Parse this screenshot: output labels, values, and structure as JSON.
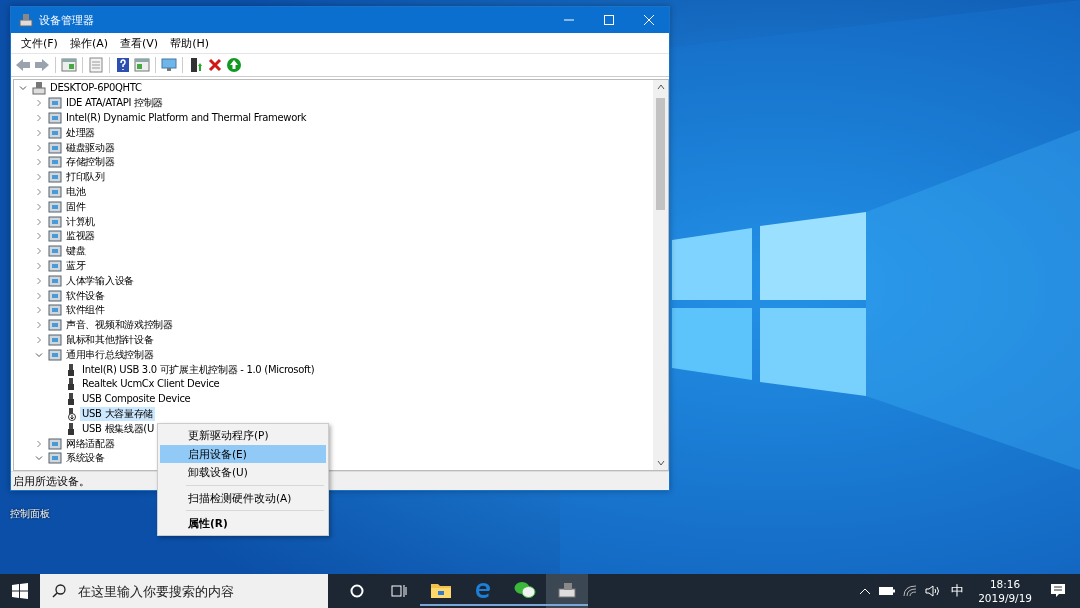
{
  "window": {
    "title": "设备管理器"
  },
  "menu_bar": [
    "文件(F)",
    "操作(A)",
    "查看(V)",
    "帮助(H)"
  ],
  "tree": [
    {
      "label": "DESKTOP-6P0QHTC",
      "expanded": true,
      "selected": false,
      "children": [
        {
          "label": "IDE ATA/ATAPI 控制器",
          "expanded": false,
          "selected": false
        },
        {
          "label": "Intel(R) Dynamic Platform and Thermal Framework",
          "expanded": false,
          "selected": false
        },
        {
          "label": "处理器",
          "expanded": false,
          "selected": false
        },
        {
          "label": "磁盘驱动器",
          "expanded": false,
          "selected": false
        },
        {
          "label": "存储控制器",
          "expanded": false,
          "selected": false
        },
        {
          "label": "打印队列",
          "expanded": false,
          "selected": false
        },
        {
          "label": "电池",
          "expanded": false,
          "selected": false
        },
        {
          "label": "固件",
          "expanded": false,
          "selected": false
        },
        {
          "label": "计算机",
          "expanded": false,
          "selected": false
        },
        {
          "label": "监视器",
          "expanded": false,
          "selected": false
        },
        {
          "label": "键盘",
          "expanded": false,
          "selected": false
        },
        {
          "label": "蓝牙",
          "expanded": false,
          "selected": false
        },
        {
          "label": "人体学输入设备",
          "expanded": false,
          "selected": false
        },
        {
          "label": "软件设备",
          "expanded": false,
          "selected": false
        },
        {
          "label": "软件组件",
          "expanded": false,
          "selected": false
        },
        {
          "label": "声音、视频和游戏控制器",
          "expanded": false,
          "selected": false
        },
        {
          "label": "鼠标和其他指针设备",
          "expanded": false,
          "selected": false
        },
        {
          "label": "通用串行总线控制器",
          "expanded": true,
          "selected": false,
          "children": [
            {
              "label": "Intel(R) USB 3.0 可扩展主机控制器 - 1.0 (Microsoft)",
              "selected": false,
              "disabled": false
            },
            {
              "label": "Realtek UcmCx Client Device",
              "selected": false,
              "disabled": false
            },
            {
              "label": "USB Composite Device",
              "selected": false,
              "disabled": false
            },
            {
              "label": "USB 大容量存储",
              "selected": true,
              "disabled": true
            },
            {
              "label": "USB 根集线器(U",
              "selected": false,
              "disabled": false
            }
          ]
        },
        {
          "label": "网络适配器",
          "expanded": false,
          "selected": false
        },
        {
          "label": "系统设备",
          "expanded": true,
          "selected": false
        }
      ]
    }
  ],
  "status_bar": "启用所选设备。",
  "context_menu": [
    [
      {
        "label": "更新驱动程序(P)",
        "selected": false,
        "bold": false
      },
      {
        "label": "启用设备(E)",
        "selected": true,
        "bold": false
      },
      {
        "label": "卸载设备(U)",
        "selected": false,
        "bold": false
      }
    ],
    [
      {
        "label": "扫描检测硬件改动(A)",
        "selected": false,
        "bold": false
      }
    ],
    [
      {
        "label": "属性(R)",
        "selected": false,
        "bold": true
      }
    ]
  ],
  "desktop_icons": [
    {
      "label": "控制面板"
    }
  ],
  "taskbar": {
    "search": {
      "placeholder": "在这里输入你要搜索的内容"
    },
    "input_method": "中",
    "time": "18:16",
    "date": "2019/9/19"
  }
}
